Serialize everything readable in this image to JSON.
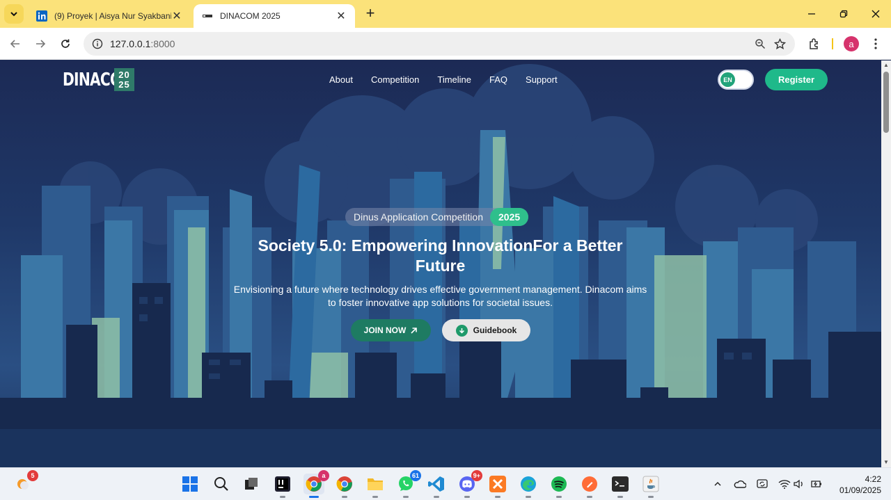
{
  "browser": {
    "tabs": [
      {
        "title": "(9) Proyek | Aisya Nur Syakbani",
        "active": false,
        "favicon": "linkedin-icon"
      },
      {
        "title": "DINACOM 2025",
        "active": true,
        "favicon": "dinacom-favicon"
      }
    ],
    "address": {
      "host": "127.0.0.1",
      "port": ":8000"
    },
    "profile_initial": "a"
  },
  "site": {
    "logo": {
      "word": "DINACOM",
      "year_top": "20",
      "year_bottom": "25"
    },
    "nav": [
      "About",
      "Competition",
      "Timeline",
      "FAQ",
      "Support"
    ],
    "lang": "EN",
    "register_label": "Register",
    "hero": {
      "pill_text": "Dinus Application Competition",
      "pill_year": "2025",
      "headline": "Society 5.0: Empowering InnovationFor a Better Future",
      "subline": "Envisioning a future where technology drives effective government management. Dinacom aims to foster innovative app solutions for societal issues.",
      "join_label": "JOIN NOW",
      "guide_label": "Guidebook"
    }
  },
  "taskbar": {
    "weather_badge": "5",
    "chrome_profile_badge": "a",
    "chrome2_badge": "",
    "whatsapp_badge": "61",
    "discord_badge": "9+",
    "time": "4:22",
    "date": "01/09/2025"
  },
  "colors": {
    "accent": "#1fb98a",
    "tab_bar": "#fbe27a",
    "join": "#1e7b62"
  }
}
